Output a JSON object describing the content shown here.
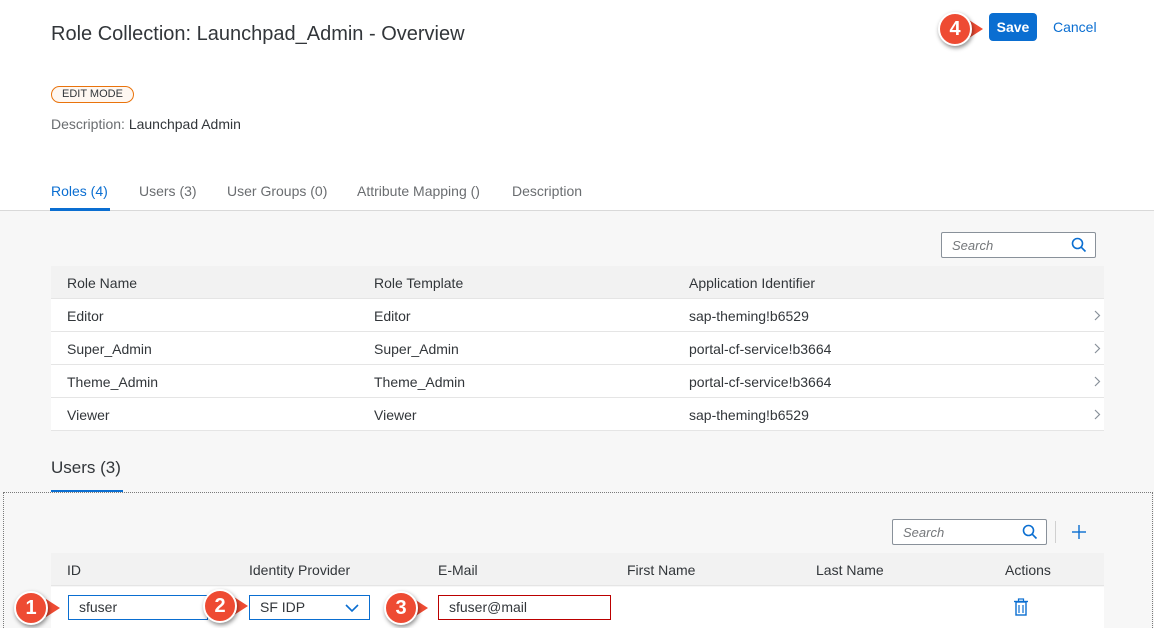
{
  "header": {
    "title": "Role Collection: Launchpad_Admin - Overview",
    "save_label": "Save",
    "cancel_label": "Cancel",
    "mode_badge": "EDIT MODE",
    "description_key": "Description:",
    "description_value": "Launchpad Admin"
  },
  "tabs": [
    {
      "label": "Roles (4)",
      "active": true
    },
    {
      "label": "Users (3)",
      "active": false
    },
    {
      "label": "User Groups (0)",
      "active": false
    },
    {
      "label": "Attribute Mapping ()",
      "active": false
    },
    {
      "label": "Description",
      "active": false
    }
  ],
  "roles": {
    "search_placeholder": "Search",
    "columns": [
      "Role Name",
      "Role Template",
      "Application Identifier"
    ],
    "rows": [
      [
        "Editor",
        "Editor",
        "sap-theming!b6529"
      ],
      [
        "Super_Admin",
        "Super_Admin",
        "portal-cf-service!b3664"
      ],
      [
        "Theme_Admin",
        "Theme_Admin",
        "portal-cf-service!b3664"
      ],
      [
        "Viewer",
        "Viewer",
        "sap-theming!b6529"
      ]
    ]
  },
  "users": {
    "section_title": "Users (3)",
    "search_placeholder": "Search",
    "columns": [
      "ID",
      "Identity Provider",
      "E-Mail",
      "First Name",
      "Last Name",
      "Actions"
    ],
    "new_row": {
      "id": "sfuser",
      "identity_provider": "SF IDP",
      "email": "sfuser@mail"
    }
  },
  "callouts": [
    "1",
    "2",
    "3",
    "4"
  ],
  "colors": {
    "accent": "#0a6ed1",
    "error": "#bb0000",
    "callout": "#ee4b33",
    "badge_border": "#e9730c"
  },
  "icons": [
    "search-icon",
    "chevron-right-icon",
    "add-icon",
    "chevron-down-icon",
    "trash-icon"
  ]
}
